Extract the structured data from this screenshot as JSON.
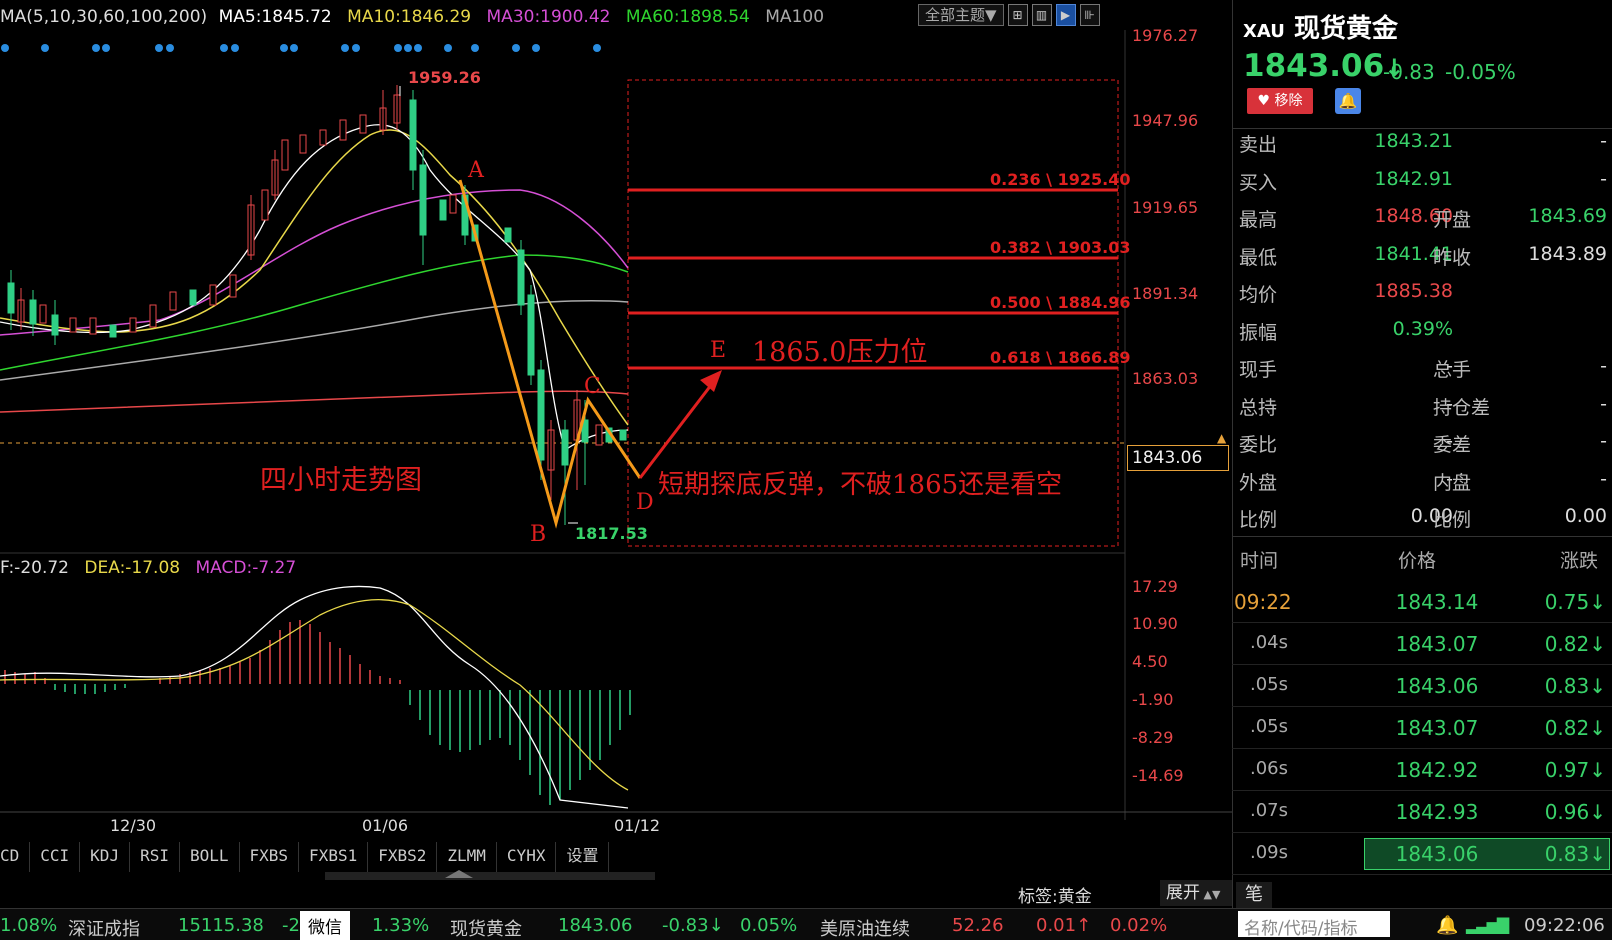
{
  "chart": {
    "ma_legend": {
      "label": "MA(5,10,30,60,100,200)",
      "ma5": "MA5:1845.72",
      "ma10": "MA10:1846.29",
      "ma30": "MA30:1900.42",
      "ma60": "MA60:1898.54",
      "ma100": "MA100"
    },
    "theme_button": "全部主题▼",
    "price_axis": [
      "1976.27",
      "1947.96",
      "1919.65",
      "1891.34",
      "1863.03"
    ],
    "current_price_tag": "1843.06",
    "high_label": "1959.26",
    "low_label": "1817.53",
    "fib_levels": [
      "0.236 \\ 1925.40",
      "0.382 \\ 1903.03",
      "0.500 \\ 1884.96",
      "0.618 \\ 1866.89"
    ],
    "wave_labels": {
      "a": "A",
      "b": "B",
      "c": "C",
      "d": "D",
      "e": "E"
    },
    "annotation_resistance": "1865.0压力位",
    "annotation_title": "四小时走势图",
    "annotation_comment": "短期探底反弹，不破1865还是看空",
    "macd_legend": {
      "diff": "F:-20.72",
      "dea": "DEA:-17.08",
      "macd": "MACD:-7.27"
    },
    "macd_axis": [
      "17.29",
      "10.90",
      "4.50",
      "-1.90",
      "-8.29",
      "-14.69"
    ],
    "date_axis": [
      "12/30",
      "01/06",
      "01/12"
    ],
    "colors": {
      "up": "#e8484a",
      "down": "#2fcf85",
      "ma5": "#ffffff",
      "ma10": "#e8d84a",
      "ma30": "#d54fd5",
      "ma60": "#2fd62f",
      "ma100": "#aaaaaa",
      "ma200": "#e8484a"
    }
  },
  "indicator_tabs": [
    "CD",
    "CCI",
    "KDJ",
    "RSI",
    "BOLL",
    "FXBS",
    "FXBS1",
    "FXBS2",
    "ZLMM",
    "CYHX",
    "设置"
  ],
  "tag_label": "标签:黄金",
  "expand_label": "展开",
  "quote": {
    "symbol": "XAU",
    "name": "现货黄金",
    "price": "1843.06",
    "arrow": "↓",
    "change": "-0.83",
    "change_pct": "-0.05%",
    "remove_label": "移除",
    "rows": [
      {
        "l1": "卖出",
        "v1": "1843.21",
        "l2": "",
        "v2": "-"
      },
      {
        "l1": "买入",
        "v1": "1842.91",
        "l2": "",
        "v2": "-"
      },
      {
        "l1": "最高",
        "v1": "1848.60",
        "l2": "开盘",
        "v2": "1843.69"
      },
      {
        "l1": "最低",
        "v1": "1841.41",
        "l2": "昨收",
        "v2": "1843.89"
      },
      {
        "l1": "均价",
        "v1": "1885.38",
        "l2": "",
        "v2": ""
      },
      {
        "l1": "振幅",
        "v1": "0.39%",
        "l2": "",
        "v2": ""
      },
      {
        "l1": "现手",
        "v1": "-",
        "l2": "总手",
        "v2": "-"
      },
      {
        "l1": "总持",
        "v1": "-",
        "l2": "持仓差",
        "v2": "-"
      },
      {
        "l1": "委比",
        "v1": "-",
        "l2": "委差",
        "v2": "-"
      },
      {
        "l1": "外盘",
        "v1": "-",
        "l2": "内盘",
        "v2": "-"
      },
      {
        "l1": "比例",
        "v1": "0.00",
        "l2": "比例",
        "v2": "0.00"
      }
    ],
    "ticks_header": {
      "time": "时间",
      "price": "价格",
      "change": "涨跌"
    },
    "ticks": [
      {
        "time": "09:22",
        "price": "1843.14",
        "change": "0.75↓"
      },
      {
        "time": ".04s",
        "price": "1843.07",
        "change": "0.82↓"
      },
      {
        "time": ".05s",
        "price": "1843.06",
        "change": "0.83↓"
      },
      {
        "time": ".05s",
        "price": "1843.07",
        "change": "0.82↓"
      },
      {
        "time": ".06s",
        "price": "1842.92",
        "change": "0.97↓"
      },
      {
        "time": ".07s",
        "price": "1842.93",
        "change": "0.96↓"
      },
      {
        "time": ".09s",
        "price": "1843.06",
        "change": "0.83↓"
      }
    ],
    "bi_label": "笔"
  },
  "status": {
    "s1": "1.08%",
    "s2": "深证成指",
    "s3": "15115.38",
    "s4": "-2",
    "wechat": "微信",
    "s5": "1.33%",
    "s6": "现货黄金",
    "s7": "1843.06",
    "s8": "-0.83↓",
    "s9": "0.05%",
    "s10": "美原油连续",
    "s11": "52.26",
    "s12": "0.01↑",
    "s13": "0.02%",
    "search_placeholder": "名称/代码/指标",
    "clock": "09:22:06"
  }
}
